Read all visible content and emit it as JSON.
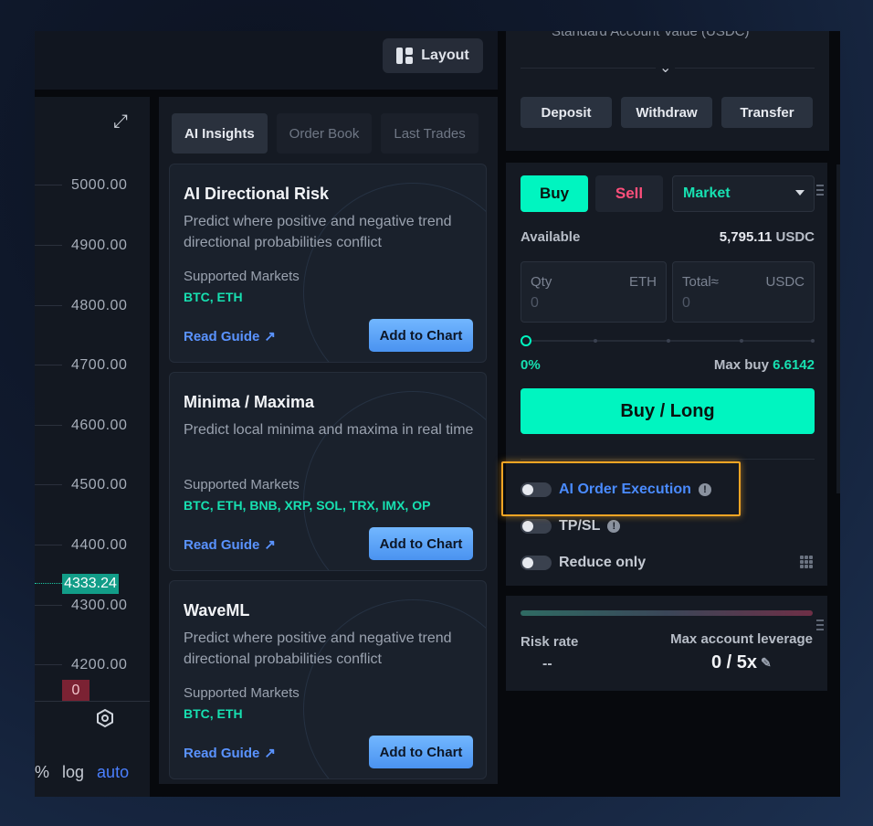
{
  "header": {
    "layout_label": "Layout"
  },
  "chart": {
    "prices": [
      "5000.00",
      "4900.00",
      "4800.00",
      "4700.00",
      "4600.00",
      "4500.00",
      "4400.00",
      "4300.00",
      "4200.00"
    ],
    "current_price": "4333.24",
    "zero_tag": "0",
    "bottom": {
      "percent": "%",
      "log": "log",
      "auto": "auto"
    }
  },
  "insights": {
    "tabs": [
      {
        "label": "AI Insights",
        "active": true
      },
      {
        "label": "Order Book",
        "active": false
      },
      {
        "label": "Last Trades",
        "active": false
      }
    ],
    "cards": [
      {
        "title": "AI Directional Risk",
        "description": "Predict where positive and negative trend directional probabilities conflict",
        "markets_label": "Supported Markets",
        "markets": "BTC, ETH",
        "guide_label": "Read Guide",
        "button_label": "Add to Chart"
      },
      {
        "title": "Minima / Maxima",
        "description": "Predict local minima and maxima in real time",
        "markets_label": "Supported Markets",
        "markets": "BTC, ETH, BNB, XRP, SOL, TRX, IMX, OP",
        "guide_label": "Read Guide",
        "button_label": "Add to Chart"
      },
      {
        "title": "WaveML",
        "description": "Predict where positive and negative trend directional probabilities conflict",
        "markets_label": "Supported Markets",
        "markets": "BTC, ETH",
        "guide_label": "Read Guide",
        "button_label": "Add to Chart"
      }
    ]
  },
  "account": {
    "title": "Standard Account Value (USDC)",
    "buttons": {
      "deposit": "Deposit",
      "withdraw": "Withdraw",
      "transfer": "Transfer"
    }
  },
  "order": {
    "buy_label": "Buy",
    "sell_label": "Sell",
    "order_type": "Market",
    "available_label": "Available",
    "available_value": "5,795.11",
    "available_unit": "USDC",
    "qty": {
      "label": "Qty",
      "unit": "ETH",
      "value": "0"
    },
    "total": {
      "label": "Total≈",
      "unit": "USDC",
      "value": "0"
    },
    "slider_percent": "0%",
    "max_buy_label": "Max buy",
    "max_buy_value": "6.6142",
    "submit_label": "Buy / Long",
    "toggles": {
      "ai_execution": "AI Order Execution",
      "tpsl": "TP/SL",
      "reduce_only": "Reduce only"
    }
  },
  "risk": {
    "risk_rate_label": "Risk rate",
    "risk_rate_value": "--",
    "leverage_label": "Max account leverage",
    "leverage_value": "0 / 5x"
  },
  "colors": {
    "accent_green": "#00f5c0",
    "sell_red": "#ff4f7b",
    "link_blue": "#5a93ff",
    "highlight_orange": "#f5a524"
  }
}
